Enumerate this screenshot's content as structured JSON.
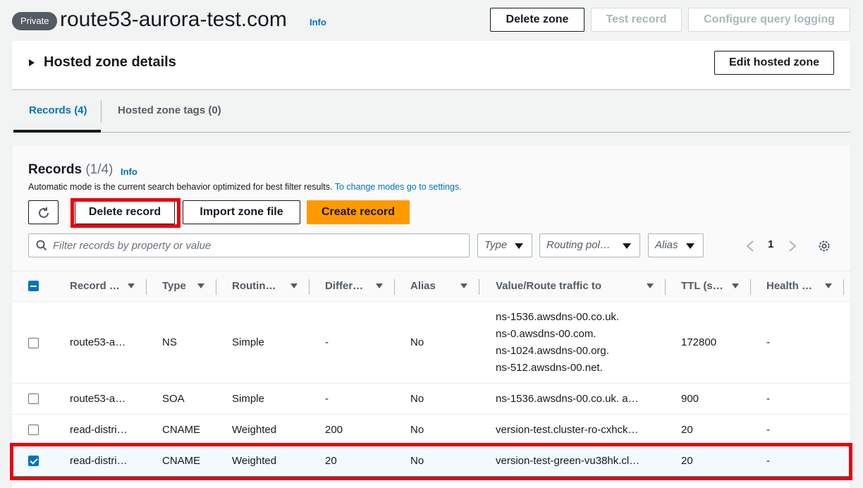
{
  "header": {
    "badge": "Private",
    "zone_name": "route53-aurora-test.com",
    "info_label": "Info",
    "buttons": {
      "delete_zone": "Delete zone",
      "test_record": "Test record",
      "configure_logging": "Configure query logging"
    }
  },
  "details": {
    "title": "Hosted zone details",
    "edit_button": "Edit hosted zone"
  },
  "tabs": [
    {
      "label": "Records (4)",
      "active": true
    },
    {
      "label": "Hosted zone tags (0)",
      "active": false
    }
  ],
  "records": {
    "title": "Records",
    "count": "(1/4)",
    "info_label": "Info",
    "description": "Automatic mode is the current search behavior optimized for best filter results.",
    "description_link": "To change modes go to settings.",
    "actions": {
      "delete": "Delete record",
      "import": "Import zone file",
      "create": "Create record"
    },
    "search_placeholder": "Filter records by property or value",
    "filters": {
      "type": "Type",
      "routing": "Routing pol…",
      "alias": "Alias"
    },
    "page": "1",
    "columns": [
      "Record …",
      "Type",
      "Routin…",
      "Differ…",
      "Alias",
      "Value/Route traffic to",
      "TTL (s…",
      "Health …"
    ],
    "rows": [
      {
        "selected": false,
        "name": "route53-a…",
        "type": "NS",
        "routing": "Simple",
        "differ": "-",
        "alias": "No",
        "value": [
          "ns-1536.awsdns-00.co.uk.",
          "ns-0.awsdns-00.com.",
          "ns-1024.awsdns-00.org.",
          "ns-512.awsdns-00.net."
        ],
        "ttl": "172800",
        "health": "-"
      },
      {
        "selected": false,
        "name": "route53-a…",
        "type": "SOA",
        "routing": "Simple",
        "differ": "-",
        "alias": "No",
        "value": [
          "ns-1536.awsdns-00.co.uk. a…"
        ],
        "ttl": "900",
        "health": "-"
      },
      {
        "selected": false,
        "name": "read-distri…",
        "type": "CNAME",
        "routing": "Weighted",
        "differ": "200",
        "alias": "No",
        "value": [
          "version-test.cluster-ro-cxhck…"
        ],
        "ttl": "20",
        "health": "-"
      },
      {
        "selected": true,
        "name": "read-distri…",
        "type": "CNAME",
        "routing": "Weighted",
        "differ": "20",
        "alias": "No",
        "value": [
          "version-test-green-vu38hk.cl…"
        ],
        "ttl": "20",
        "health": "-"
      }
    ]
  },
  "colors": {
    "accent": "#0073bb",
    "primary_button": "#ff9900",
    "highlight": "#e8000c"
  }
}
